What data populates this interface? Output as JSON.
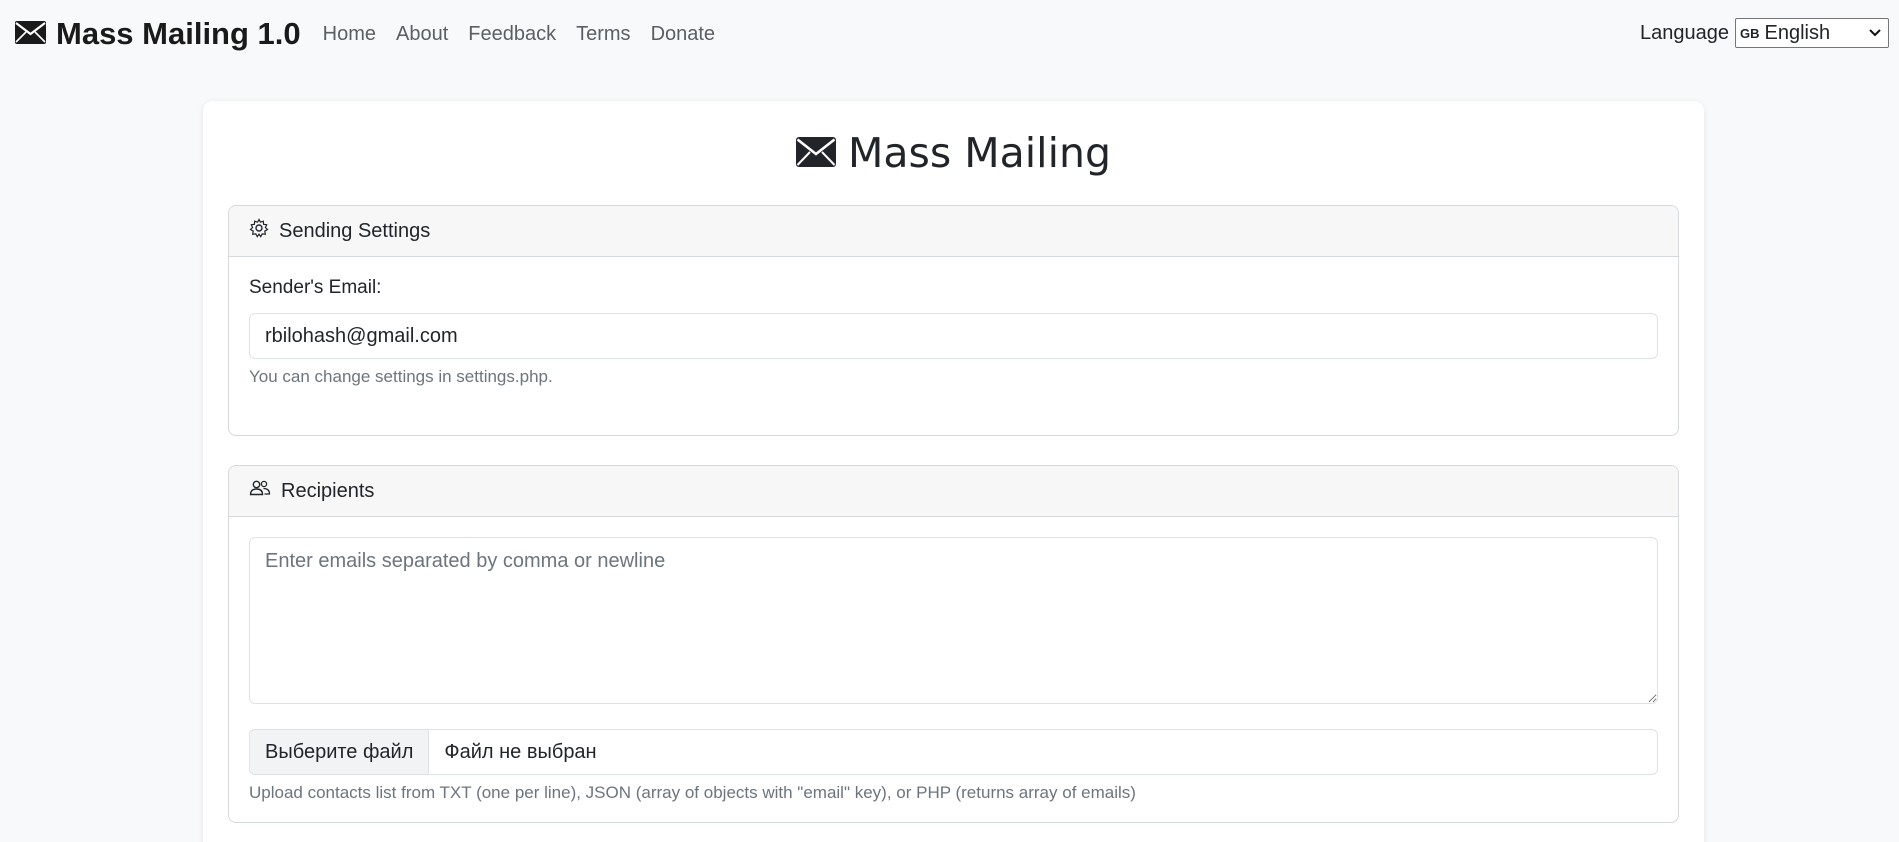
{
  "nav": {
    "brand": "Mass Mailing 1.0",
    "links": [
      "Home",
      "About",
      "Feedback",
      "Terms",
      "Donate"
    ],
    "language_label": "Language",
    "language_flag": "GB",
    "language_value": "English"
  },
  "page": {
    "title": "Mass Mailing"
  },
  "sending": {
    "header": "Sending Settings",
    "sender_label": "Sender's Email:",
    "sender_value": "rbilohash@gmail.com",
    "help": "You can change settings in settings.php."
  },
  "recipients": {
    "header": "Recipients",
    "placeholder": "Enter emails separated by comma or newline",
    "file_button": "Выберите файл",
    "file_status": "Файл не выбран",
    "help": "Upload contacts list from TXT (one per line), JSON (array of objects with \"email\" key), or PHP (returns array of emails)"
  },
  "icons": {
    "brand": "envelope-icon",
    "title": "envelope-icon",
    "sending": "gear-icon",
    "recipients": "people-icon"
  }
}
